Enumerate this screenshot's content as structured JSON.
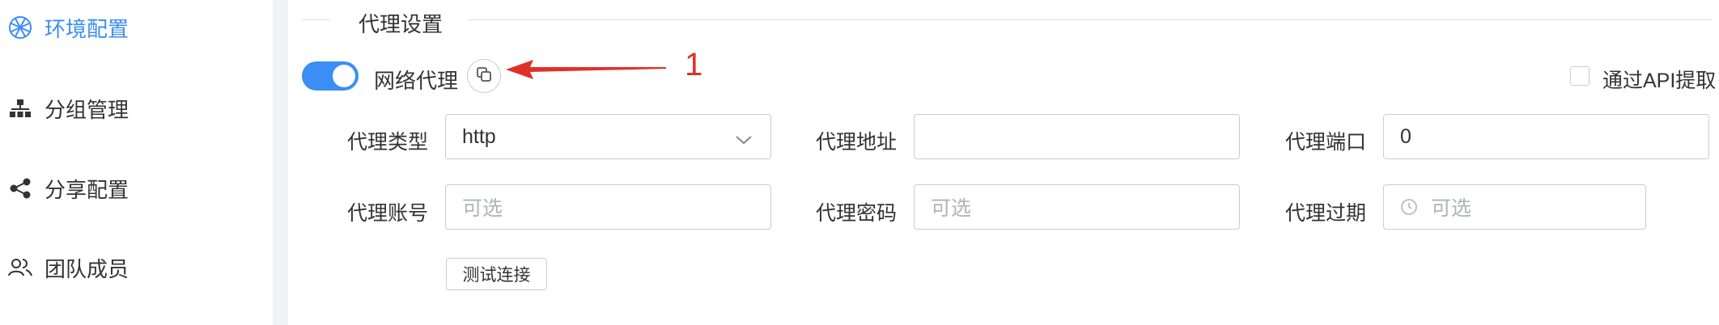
{
  "sidebar": {
    "items": [
      {
        "label": "环境配置",
        "icon": "globe-icon",
        "active": true
      },
      {
        "label": "分组管理",
        "icon": "org-tree-icon",
        "active": false
      },
      {
        "label": "分享配置",
        "icon": "share-icon",
        "active": false
      },
      {
        "label": "团队成员",
        "icon": "team-icon",
        "active": false
      }
    ]
  },
  "section": {
    "title": "代理设置"
  },
  "proxy": {
    "toggle_label": "网络代理",
    "toggle_on": true,
    "annotation_number": "1",
    "api_label": "通过API提取"
  },
  "fields": {
    "type_label": "代理类型",
    "type_value": "http",
    "address_label": "代理地址",
    "address_value": "",
    "port_label": "代理端口",
    "port_value": "0",
    "account_label": "代理账号",
    "account_placeholder": "可选",
    "password_label": "代理密码",
    "password_placeholder": "可选",
    "expire_label": "代理过期",
    "expire_placeholder": "可选"
  },
  "actions": {
    "test_label": "测试连接"
  },
  "colors": {
    "accent": "#3a8ef6",
    "annotation": "#e0302a",
    "border": "#c9ccd3",
    "placeholder": "#b0b3ba"
  }
}
